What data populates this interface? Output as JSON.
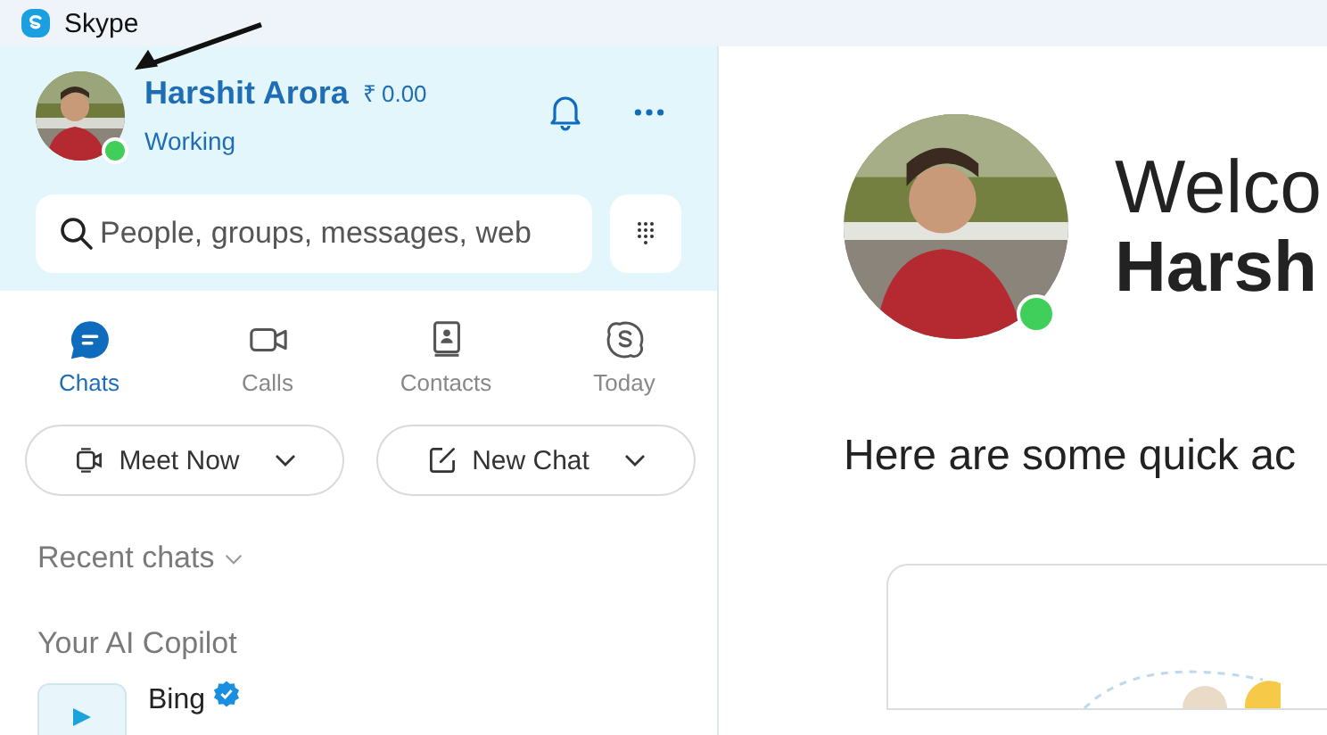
{
  "window": {
    "title": "Skype"
  },
  "profile": {
    "name": "Harshit Arora",
    "credit": "₹ 0.00",
    "status": "Working",
    "online": true
  },
  "search": {
    "placeholder": "People, groups, messages, web"
  },
  "tabs": [
    {
      "label": "Chats",
      "kind": "chat",
      "selected": true
    },
    {
      "label": "Calls",
      "kind": "video",
      "selected": false
    },
    {
      "label": "Contacts",
      "kind": "book",
      "selected": false
    },
    {
      "label": "Today",
      "kind": "skype",
      "selected": false
    }
  ],
  "actions": [
    {
      "label": "Meet Now",
      "kind": "meet"
    },
    {
      "label": "New Chat",
      "kind": "compose"
    }
  ],
  "recent_chats": {
    "label": "Recent chats"
  },
  "copilot": {
    "heading": "Your AI Copilot",
    "items": [
      {
        "name": "Bing",
        "verified": true
      }
    ]
  },
  "welcome": {
    "line_1": "Welco",
    "line_2": "Harsh",
    "online": true,
    "quick_actions": "Here are some quick ac"
  }
}
